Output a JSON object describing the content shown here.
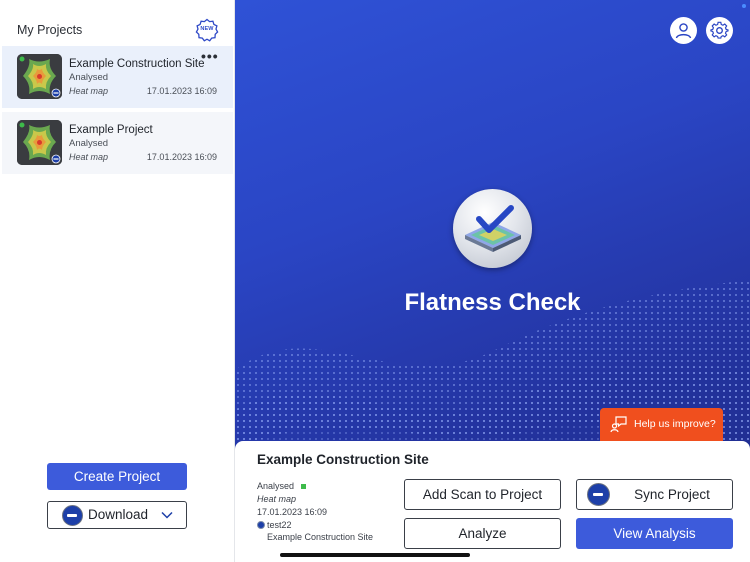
{
  "sidebar": {
    "title": "My Projects",
    "new_badge": "NEW",
    "projects": [
      {
        "name": "Example Construction Site",
        "status": "Analysed",
        "type": "Heat map",
        "date": "17.01.2023 16:09",
        "selected": true
      },
      {
        "name": "Example Project",
        "status": "Analysed",
        "type": "Heat map",
        "date": "17.01.2023 16:09",
        "selected": false
      }
    ],
    "create_button": "Create Project",
    "download_button": "Download"
  },
  "main": {
    "app_title": "Flatness Check",
    "help_button": "Help us improve?"
  },
  "detail": {
    "title": "Example Construction Site",
    "status": "Analysed",
    "type": "Heat map",
    "date": "17.01.2023 16:09",
    "scan_name": "test22",
    "scan_site": "Example Construction Site",
    "add_scan_button": "Add Scan to Project",
    "analyze_button": "Analyze",
    "sync_button": "Sync Project",
    "view_button": "View Analysis"
  },
  "colors": {
    "accent": "#3d5bdb",
    "main_background": "#2a45c4",
    "help_button": "#f04f1e",
    "status_green": "#3dbb4a"
  },
  "icons": {
    "new": "new-badge-icon",
    "more": "more-dots-icon",
    "user": "user-icon",
    "settings": "gear-icon",
    "help": "feedback-chat-icon",
    "chevron": "chevron-down-icon"
  }
}
